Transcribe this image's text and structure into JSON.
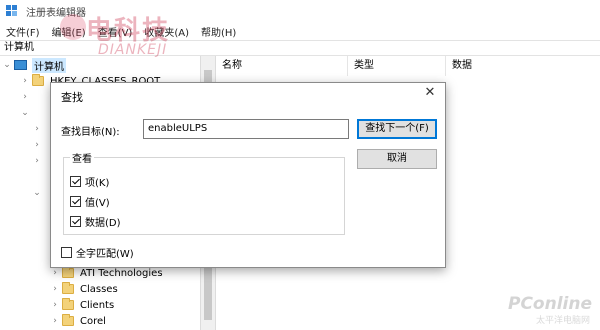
{
  "window": {
    "title": "注册表编辑器"
  },
  "menu": [
    "文件(F)",
    "编辑(E)",
    "查看(V)",
    "收藏夹(A)",
    "帮助(H)"
  ],
  "address": "计算机",
  "tree": {
    "root": "计算机",
    "hkcr": "HKEY_CLASSES_ROOT",
    "items": [
      "ATI Technologies",
      "Classes",
      "Clients",
      "Corel"
    ]
  },
  "list_columns": [
    "名称",
    "类型",
    "数据"
  ],
  "dialog": {
    "title": "查找",
    "find_label": "查找目标(N):",
    "find_value": "enableULPS",
    "find_next": "查找下一个(F)",
    "cancel": "取消",
    "look_at": "查看",
    "options": [
      {
        "label": "项(K)",
        "checked": true
      },
      {
        "label": "值(V)",
        "checked": true
      },
      {
        "label": "数据(D)",
        "checked": true
      }
    ],
    "match_whole": {
      "label": "全字匹配(W)",
      "checked": false
    }
  },
  "watermarks": {
    "brand_cn": "电科技",
    "brand_en": "DIANKEJI",
    "pconline": "PConline",
    "pconline_sub": "太平洋电脑网"
  }
}
